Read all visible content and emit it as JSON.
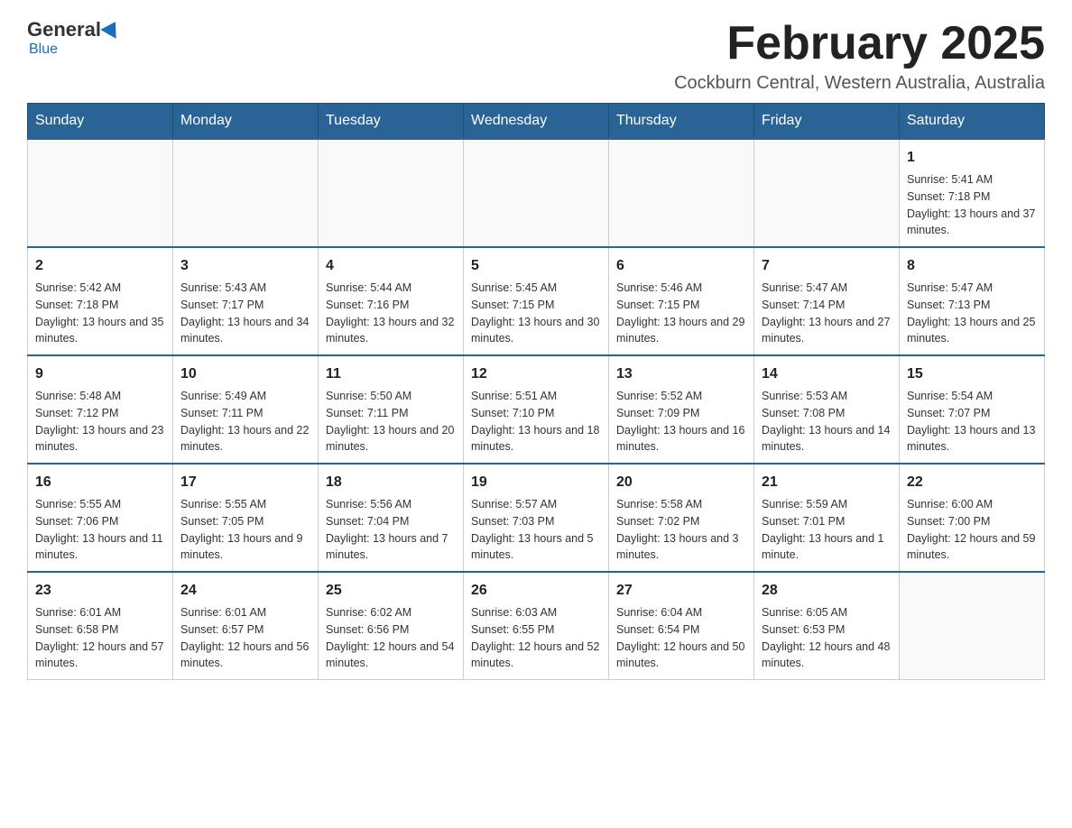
{
  "logo": {
    "general": "General",
    "blue": "Blue"
  },
  "title": "February 2025",
  "subtitle": "Cockburn Central, Western Australia, Australia",
  "days_of_week": [
    "Sunday",
    "Monday",
    "Tuesday",
    "Wednesday",
    "Thursday",
    "Friday",
    "Saturday"
  ],
  "weeks": [
    [
      {
        "day": "",
        "info": ""
      },
      {
        "day": "",
        "info": ""
      },
      {
        "day": "",
        "info": ""
      },
      {
        "day": "",
        "info": ""
      },
      {
        "day": "",
        "info": ""
      },
      {
        "day": "",
        "info": ""
      },
      {
        "day": "1",
        "info": "Sunrise: 5:41 AM\nSunset: 7:18 PM\nDaylight: 13 hours and 37 minutes."
      }
    ],
    [
      {
        "day": "2",
        "info": "Sunrise: 5:42 AM\nSunset: 7:18 PM\nDaylight: 13 hours and 35 minutes."
      },
      {
        "day": "3",
        "info": "Sunrise: 5:43 AM\nSunset: 7:17 PM\nDaylight: 13 hours and 34 minutes."
      },
      {
        "day": "4",
        "info": "Sunrise: 5:44 AM\nSunset: 7:16 PM\nDaylight: 13 hours and 32 minutes."
      },
      {
        "day": "5",
        "info": "Sunrise: 5:45 AM\nSunset: 7:15 PM\nDaylight: 13 hours and 30 minutes."
      },
      {
        "day": "6",
        "info": "Sunrise: 5:46 AM\nSunset: 7:15 PM\nDaylight: 13 hours and 29 minutes."
      },
      {
        "day": "7",
        "info": "Sunrise: 5:47 AM\nSunset: 7:14 PM\nDaylight: 13 hours and 27 minutes."
      },
      {
        "day": "8",
        "info": "Sunrise: 5:47 AM\nSunset: 7:13 PM\nDaylight: 13 hours and 25 minutes."
      }
    ],
    [
      {
        "day": "9",
        "info": "Sunrise: 5:48 AM\nSunset: 7:12 PM\nDaylight: 13 hours and 23 minutes."
      },
      {
        "day": "10",
        "info": "Sunrise: 5:49 AM\nSunset: 7:11 PM\nDaylight: 13 hours and 22 minutes."
      },
      {
        "day": "11",
        "info": "Sunrise: 5:50 AM\nSunset: 7:11 PM\nDaylight: 13 hours and 20 minutes."
      },
      {
        "day": "12",
        "info": "Sunrise: 5:51 AM\nSunset: 7:10 PM\nDaylight: 13 hours and 18 minutes."
      },
      {
        "day": "13",
        "info": "Sunrise: 5:52 AM\nSunset: 7:09 PM\nDaylight: 13 hours and 16 minutes."
      },
      {
        "day": "14",
        "info": "Sunrise: 5:53 AM\nSunset: 7:08 PM\nDaylight: 13 hours and 14 minutes."
      },
      {
        "day": "15",
        "info": "Sunrise: 5:54 AM\nSunset: 7:07 PM\nDaylight: 13 hours and 13 minutes."
      }
    ],
    [
      {
        "day": "16",
        "info": "Sunrise: 5:55 AM\nSunset: 7:06 PM\nDaylight: 13 hours and 11 minutes."
      },
      {
        "day": "17",
        "info": "Sunrise: 5:55 AM\nSunset: 7:05 PM\nDaylight: 13 hours and 9 minutes."
      },
      {
        "day": "18",
        "info": "Sunrise: 5:56 AM\nSunset: 7:04 PM\nDaylight: 13 hours and 7 minutes."
      },
      {
        "day": "19",
        "info": "Sunrise: 5:57 AM\nSunset: 7:03 PM\nDaylight: 13 hours and 5 minutes."
      },
      {
        "day": "20",
        "info": "Sunrise: 5:58 AM\nSunset: 7:02 PM\nDaylight: 13 hours and 3 minutes."
      },
      {
        "day": "21",
        "info": "Sunrise: 5:59 AM\nSunset: 7:01 PM\nDaylight: 13 hours and 1 minute."
      },
      {
        "day": "22",
        "info": "Sunrise: 6:00 AM\nSunset: 7:00 PM\nDaylight: 12 hours and 59 minutes."
      }
    ],
    [
      {
        "day": "23",
        "info": "Sunrise: 6:01 AM\nSunset: 6:58 PM\nDaylight: 12 hours and 57 minutes."
      },
      {
        "day": "24",
        "info": "Sunrise: 6:01 AM\nSunset: 6:57 PM\nDaylight: 12 hours and 56 minutes."
      },
      {
        "day": "25",
        "info": "Sunrise: 6:02 AM\nSunset: 6:56 PM\nDaylight: 12 hours and 54 minutes."
      },
      {
        "day": "26",
        "info": "Sunrise: 6:03 AM\nSunset: 6:55 PM\nDaylight: 12 hours and 52 minutes."
      },
      {
        "day": "27",
        "info": "Sunrise: 6:04 AM\nSunset: 6:54 PM\nDaylight: 12 hours and 50 minutes."
      },
      {
        "day": "28",
        "info": "Sunrise: 6:05 AM\nSunset: 6:53 PM\nDaylight: 12 hours and 48 minutes."
      },
      {
        "day": "",
        "info": ""
      }
    ]
  ]
}
